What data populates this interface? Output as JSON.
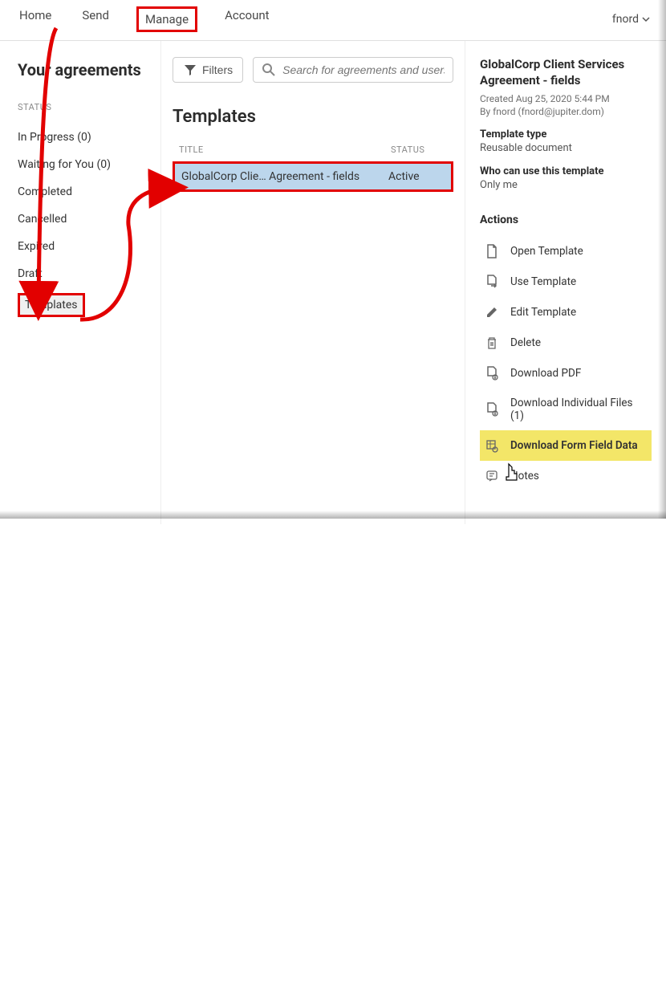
{
  "nav": {
    "home": "Home",
    "send": "Send",
    "manage": "Manage",
    "account": "Account",
    "user": "fnord"
  },
  "sidebar": {
    "heading": "Your agreements",
    "statusLabel": "STATUS",
    "items": {
      "inProgress": "In Progress (0)",
      "waiting": "Waiting for You (0)",
      "completed": "Completed",
      "cancelled": "Cancelled",
      "expired": "Expired",
      "draft": "Draft",
      "templates": "Templates"
    }
  },
  "center": {
    "filtersLabel": "Filters",
    "searchPlaceholder": "Search for agreements and users...",
    "heading": "Templates",
    "columns": {
      "title": "TITLE",
      "status": "STATUS"
    },
    "row": {
      "title": "GlobalCorp Clie…  Agreement - fields",
      "status": "Active"
    }
  },
  "details": {
    "title": "GlobalCorp Client Services Agreement - fields",
    "created": "Created Aug 25, 2020 5:44 PM",
    "by": "By fnord (fnord@jupiter.dom)",
    "templateTypeLabel": "Template type",
    "templateTypeValue": "Reusable document",
    "whoLabel": "Who can use this template",
    "whoValue": "Only me",
    "actionsHeading": "Actions",
    "actions": {
      "open": "Open Template",
      "use": "Use Template",
      "edit": "Edit Template",
      "delete": "Delete",
      "downloadPdf": "Download PDF",
      "downloadIndividual": "Download Individual Files (1)",
      "downloadFormData": "Download Form Field Data",
      "notes": "Notes"
    }
  }
}
